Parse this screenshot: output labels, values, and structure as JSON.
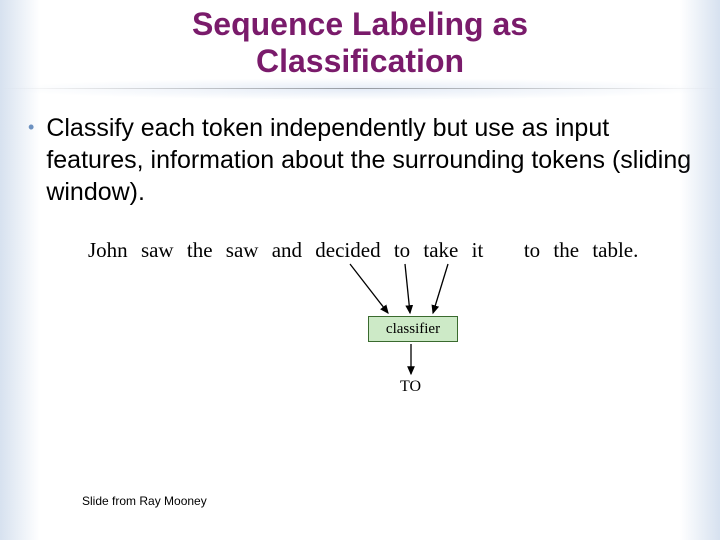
{
  "title_line1": "Sequence Labeling as",
  "title_line2": "Classification",
  "bullet": "Classify each token independently but use as input features, information about the surrounding tokens (sliding window).",
  "sentence_tokens": [
    "John",
    "saw",
    "the",
    "saw",
    "and",
    "decided",
    "to",
    "take",
    "it",
    "to",
    "the",
    "table."
  ],
  "classifier_label": "classifier",
  "output_tag": "TO",
  "footer": "Slide from Ray Mooney",
  "colors": {
    "title": "#7a1b6b",
    "bullet_dot": "#6a8fbf",
    "box_fill": "#cdeac7",
    "box_border": "#3a6a2e"
  }
}
